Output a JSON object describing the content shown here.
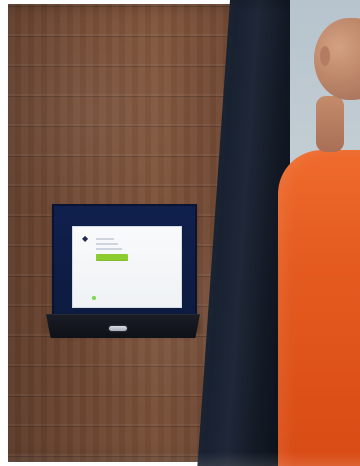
{
  "scene": {
    "icons": {
      "terminal_logo": "logo-icon",
      "status_indicator": "status-light-icon",
      "badge_slot": "badge-slot-icon"
    },
    "colors": {
      "wall_wood": "#7b4f37",
      "door_frame": "#1b2433",
      "terminal_housing": "#10204d",
      "screen_background": "#f5f7f9",
      "screen_action": "#8ccc2f",
      "person_clothing": "#e45b1f"
    }
  }
}
